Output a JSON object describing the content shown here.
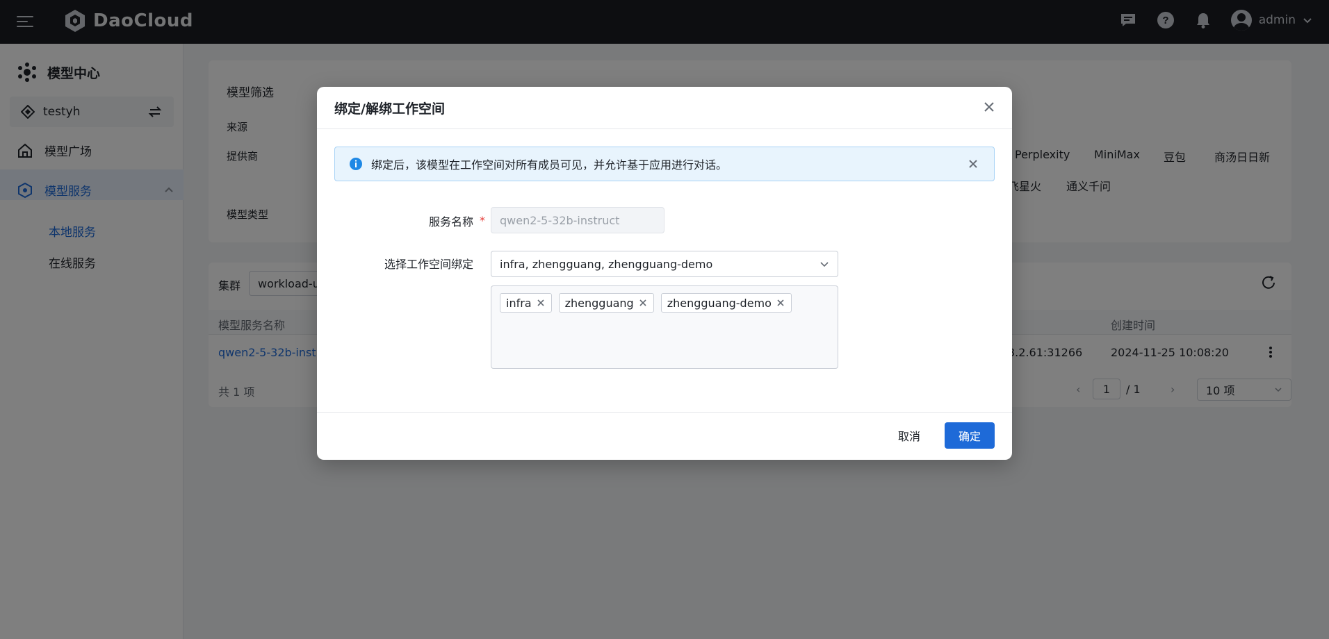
{
  "app": {
    "brand": "DaoCloud",
    "user": "admin"
  },
  "sidebar": {
    "title": "模型中心",
    "workspace": "testyh",
    "items": [
      {
        "label": "模型广场"
      },
      {
        "label": "模型服务"
      }
    ],
    "sub_items": [
      {
        "label": "本地服务"
      },
      {
        "label": "在线服务"
      }
    ]
  },
  "filters": {
    "title": "模型筛选",
    "source_label": "来源",
    "provider_label": "提供商",
    "type_label": "模型类型",
    "providers_row1": [
      "Perplexity",
      "MiniMax",
      "豆包",
      "商汤日日新"
    ],
    "providers_row2": [
      "飞星火",
      "通义千问"
    ]
  },
  "table": {
    "cluster_label": "集群",
    "cluster_value": "workload-u",
    "columns": {
      "name": "模型服务名称",
      "created": "创建时间"
    },
    "row": {
      "name": "qwen2-5-32b-instr",
      "endpoint": "3.2.61:31266",
      "created": "2024-11-25 10:08:20"
    },
    "total": "共 1 项",
    "pagination": {
      "page": "1",
      "pages": "/ 1",
      "page_size": "10 项"
    }
  },
  "modal": {
    "title": "绑定/解绑工作空间",
    "alert": "绑定后，该模型在工作空间对所有成员可见，并允许基于应用进行对话。",
    "service_name_label": "服务名称",
    "service_name_placeholder": "qwen2-5-32b-instruct",
    "workspace_label": "选择工作空间绑定",
    "workspace_value": "infra, zhengguang, zhengguang-demo",
    "tags": [
      "infra",
      "zhengguang",
      "zhengguang-demo"
    ],
    "cancel": "取消",
    "confirm": "确定"
  },
  "colors": {
    "accent": "#1e6ad8",
    "topbar": "#1b1d22",
    "overlay": "rgba(0,0,0,0.5)"
  }
}
